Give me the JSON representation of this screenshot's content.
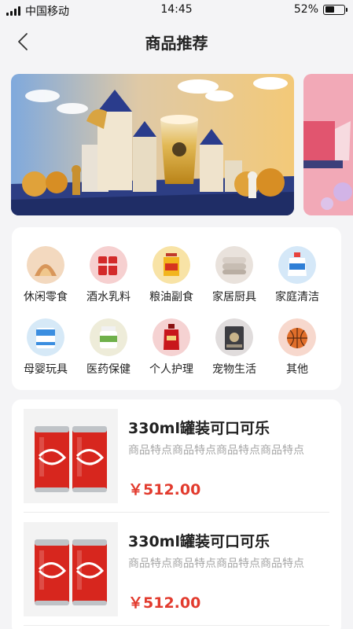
{
  "status_bar": {
    "carrier": "中国移动",
    "time": "14:45",
    "battery_percent": "52%",
    "battery_level": 0.52,
    "signal_icon": "signal-bars-icon",
    "battery_icon": "battery-icon"
  },
  "nav": {
    "title": "商品推荐",
    "back_icon": "chevron-left-icon"
  },
  "banners": [
    {
      "name": "banner-castle-bubble-tea"
    },
    {
      "name": "banner-pink-next-preview"
    }
  ],
  "categories": [
    {
      "label": "休闲零食",
      "icon": "snack-icon",
      "bg": "#f3d9bf"
    },
    {
      "label": "酒水乳料",
      "icon": "cola-cans-icon",
      "bg": "#f6d0d0"
    },
    {
      "label": "粮油副食",
      "icon": "cooking-oil-icon",
      "bg": "#f8e3a6"
    },
    {
      "label": "家居厨具",
      "icon": "towel-icon",
      "bg": "#e9e2dc"
    },
    {
      "label": "家庭清洁",
      "icon": "detergent-icon",
      "bg": "#d5e8f8"
    },
    {
      "label": "母婴玩具",
      "icon": "milk-powder-icon",
      "bg": "#d6e9f7"
    },
    {
      "label": "医药保健",
      "icon": "supplement-bottle-icon",
      "bg": "#eeecd9"
    },
    {
      "label": "个人护理",
      "icon": "shampoo-icon",
      "bg": "#f5d2d2"
    },
    {
      "label": "宠物生活",
      "icon": "pet-food-icon",
      "bg": "#e0dcdc"
    },
    {
      "label": "其他",
      "icon": "basketball-icon",
      "bg": "#f7d8cd"
    }
  ],
  "products": [
    {
      "title": "330ml罐装可口可乐",
      "desc": "商品特点商品特点商品特点商品特点",
      "price": "￥512.00",
      "image_icon": "coca-cola-cans-image"
    },
    {
      "title": "330ml罐装可口可乐",
      "desc": "商品特点商品特点商品特点商品特点",
      "price": "￥512.00",
      "image_icon": "coca-cola-cans-image"
    }
  ],
  "colors": {
    "accent_price": "#e23b2e",
    "page_bg": "#f4f4f6",
    "card_bg": "#ffffff",
    "desc_gray": "#a6a6a6"
  }
}
